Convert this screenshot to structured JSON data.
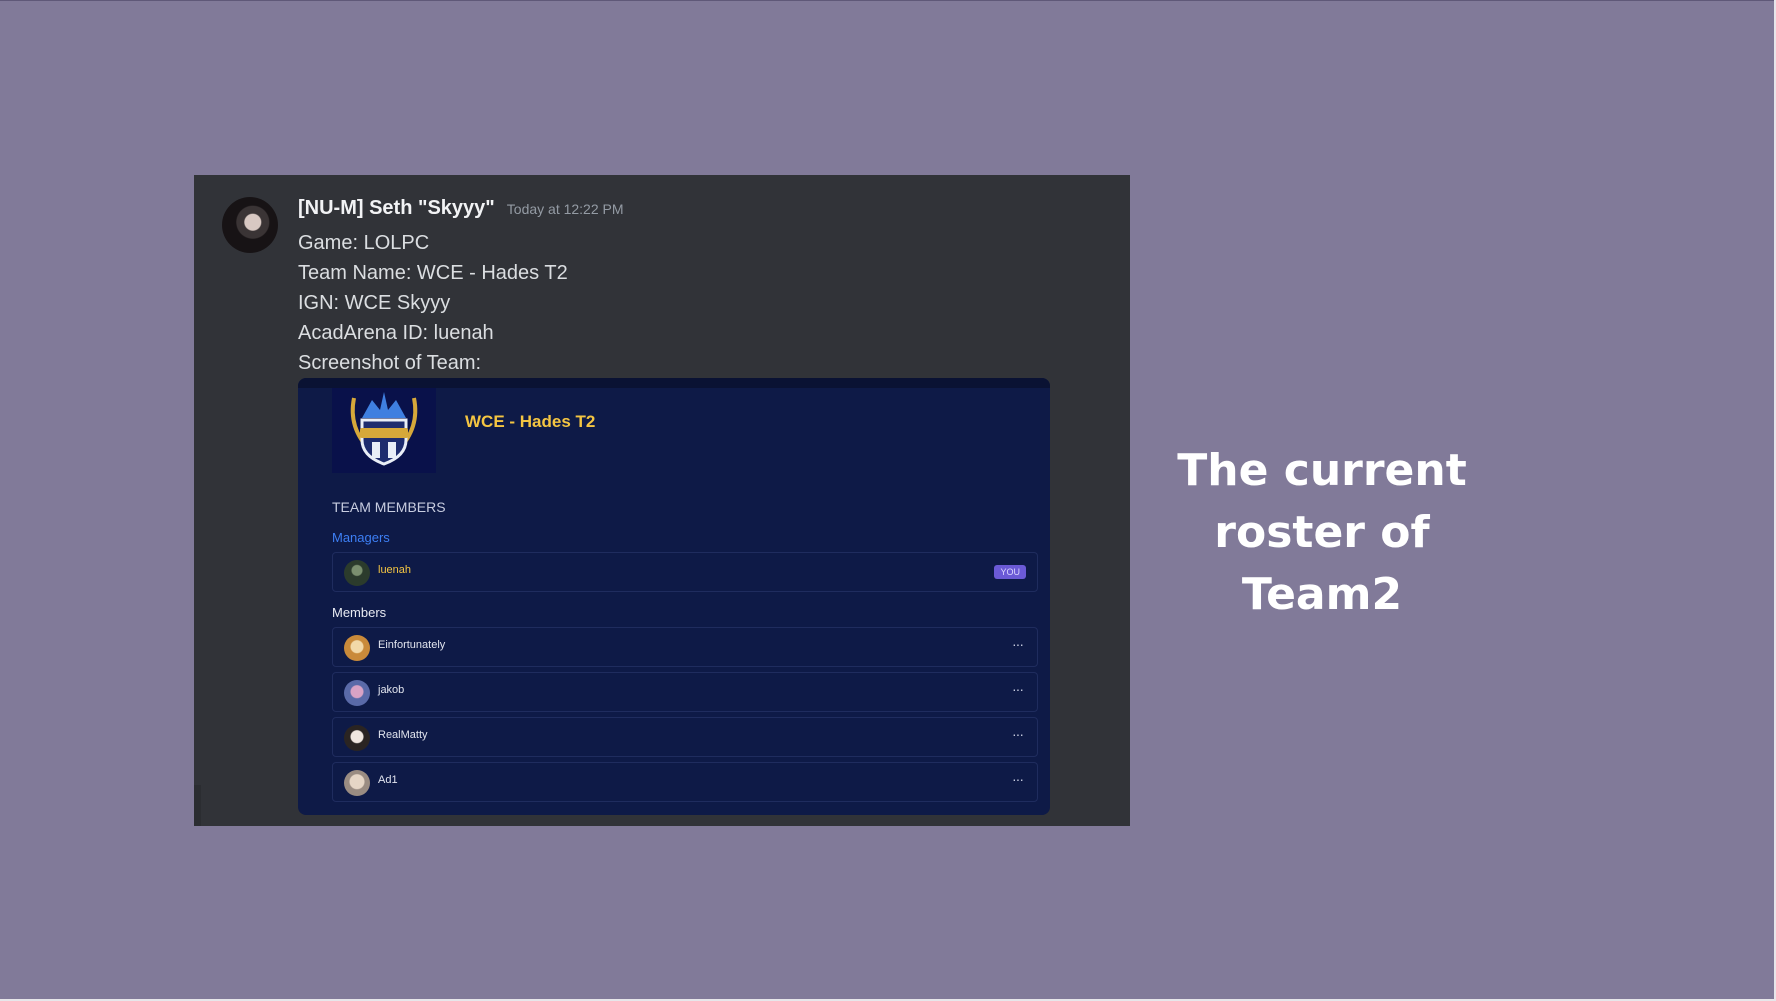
{
  "message": {
    "author": "[NU-M] Seth \"Skyyy\"",
    "timestamp": "Today at 12:22 PM",
    "lines": [
      "Game: LOLPC",
      "Team Name: WCE - Hades T2",
      "IGN: WCE Skyyy",
      "AcadArena ID: luenah",
      "Screenshot of Team:"
    ]
  },
  "embed": {
    "team_name": "WCE - Hades T2",
    "section_title": "TEAM MEMBERS",
    "managers_label": "Managers",
    "manager": {
      "name": "luenah",
      "badge": "YOU"
    },
    "members_label": "Members",
    "members": [
      {
        "name": "Einfortunately",
        "action": "···"
      },
      {
        "name": "jakob",
        "action": "···"
      },
      {
        "name": "RealMatty",
        "action": "···"
      },
      {
        "name": "Ad1",
        "action": "···"
      }
    ]
  },
  "caption": "The current roster of Team2",
  "colors": {
    "background": "#817a99",
    "discord_bg": "#313338",
    "embed_bg": "#0e1a47",
    "team_name": "#f4c542",
    "managers_label": "#3d7ff5",
    "you_badge": "#6b5ad6"
  }
}
